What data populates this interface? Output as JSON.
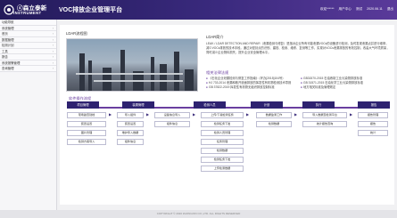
{
  "header": {
    "logo_main": "ⓢ森立泰新",
    "logo_sub": "INSTRUMENT",
    "app_title": "VOC排放企业管理平台",
    "user_text": "欢迎******",
    "user_center": "用户中心",
    "link_1": "测试",
    "date": "2020.06.11",
    "link_2": "退出"
  },
  "sidebar": {
    "items": [
      {
        "label": "功能导航",
        "arrow": ""
      },
      {
        "label": "系统管理",
        "arrow": "›"
      },
      {
        "label": "首页",
        "arrow": "›"
      },
      {
        "label": "数据管理",
        "arrow": "›"
      },
      {
        "label": "检测计划",
        "arrow": "›"
      },
      {
        "label": "工具",
        "arrow": "›"
      },
      {
        "label": "报告",
        "arrow": "›"
      },
      {
        "label": "系统报警管理",
        "arrow": "›"
      },
      {
        "label": "查询管理",
        "arrow": "›"
      }
    ]
  },
  "content": {
    "flow_title": "LDAR流程图",
    "intro_title": "LDAR简介",
    "intro_text": "LEAK / LDAR DETECTION AND REPAIR（泄漏检测与修复）是指对企业所有可能泄漏VOCs的设备进行检测，及时发现泄漏点并进行维修，减少VOCs排放的技术手段。通过对密封点的识别、建档、检测、维修、复测等工作，实现对VOCs泄漏排放的有效控制，改善大气环境质量，同时减少企业物料损失，提升企业安全管理水平。",
    "standards_title": "相关法律法规",
    "standards": [
      {
        "bullet": "●",
        "text": "《石化企业泄漏检测与修复工作指南》（环办[2015]104号）"
      },
      {
        "bullet": "●",
        "text": "GB31570-2015 石油炼制工业污染物排放标准"
      },
      {
        "bullet": "●",
        "text": "HJ 733-2014 泄漏和敞开液面排放的挥发性有机物检测技术导则"
      },
      {
        "bullet": "●",
        "text": "GB 31571-2015 石油化学工业污染物排放标准"
      },
      {
        "bullet": "●",
        "text": "GB 37822-2019 挥发性有机物无组织排放控制标准"
      },
      {
        "bullet": "●",
        "text": "地方相关标准及管理规定"
      }
    ],
    "process_title": "软件操作流程",
    "stages": [
      "项目管理",
      "装置管理",
      "检测人员",
      "计划",
      "执行",
      "报告"
    ],
    "boxes": {
      "r1": [
        "现场勘查建档",
        "导入组件",
        "设备信息导入",
        "上传/下载检测任务",
        "数据监测工作",
        "导入数据至检测平台",
        "报告管理"
      ],
      "r2": [
        "装置设置",
        "装置设置",
        "组件信息",
        "检测任务下发",
        "检测数据",
        "统计报告查询",
        "报告"
      ],
      "r3": [
        "图片管理",
        "维护导入数据",
        "",
        "检测人员管理",
        "",
        "",
        "统计"
      ],
      "r4": [
        "检测方案导入",
        "组件信息",
        "",
        "任务管理",
        "",
        "",
        ""
      ],
      "r5": [
        "",
        "",
        "",
        "检测数据",
        "",
        "",
        ""
      ],
      "r6": [
        "",
        "",
        "",
        "检测任务下发",
        "",
        "",
        ""
      ],
      "r7": [
        "",
        "",
        "",
        "上传检测数据",
        "",
        "",
        ""
      ]
    }
  },
  "footer": {
    "text": "COPYRIGHT © 2020 ZHONGXIN CO.,LTD. ALL RIGHTS RESERVED"
  },
  "colors": {
    "header_start": "#231a5a",
    "header_end": "#5a3a9a",
    "stage_bg": "#2e2270",
    "accent": "#6a3fa0"
  }
}
